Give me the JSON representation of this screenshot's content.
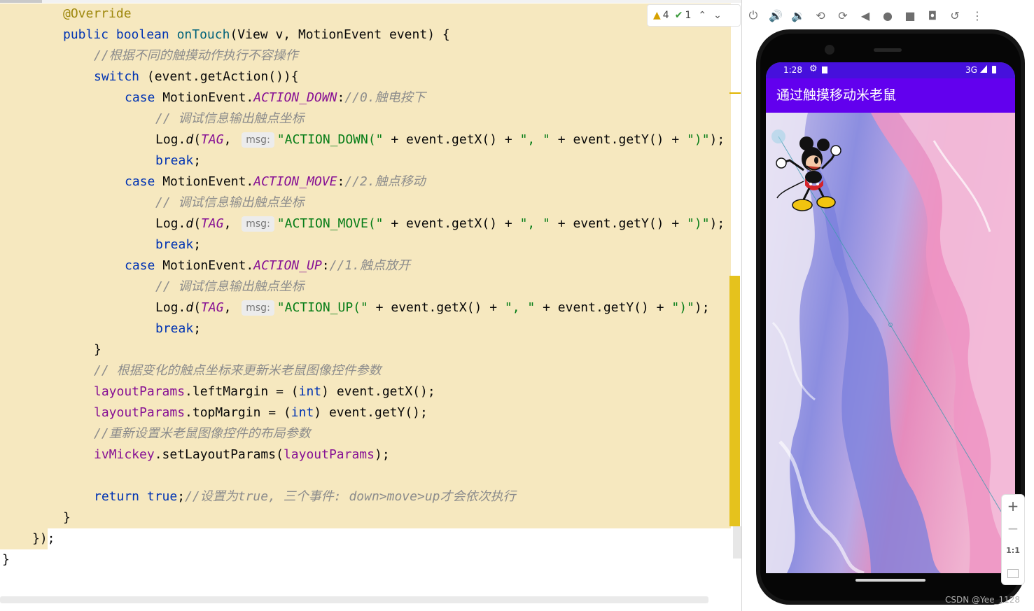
{
  "editor": {
    "inspections": {
      "warnings": "4",
      "checks": "1"
    },
    "code": {
      "l1_annotation": "@Override",
      "l2_public": "public",
      "l2_boolean": "boolean",
      "l2_method": "onTouch",
      "l2_params": "(View v, MotionEvent event) {",
      "l3_comment": "//根据不同的触摸动作执行不容操作",
      "l4_switch": "switch",
      "l4_rest": " (event.getAction()){",
      "case_kw": "case",
      "motion_event": " MotionEvent.",
      "l5_const": "ACTION_DOWN",
      "l5_comment": ":",
      "l5_comment2": "//0.触电按下",
      "debug_comment": "// 调试信息输出触点坐标",
      "log_d": "Log.",
      "d": "d",
      "tag": "TAG",
      "comma": ", ",
      "msg_hint": "msg:",
      "str_down": "\"ACTION_DOWN(\"",
      "getx_part": " + event.getX() + ",
      "str_sep": "\", \"",
      "gety_part": " + event.getY() + ",
      "str_close": "\")\"",
      "end_call": ");",
      "break_kw": "break",
      "semicolon": ";",
      "l9_const": "ACTION_MOVE",
      "l9_comment": "//2.触点移动",
      "str_move": "\"ACTION_MOVE(\"",
      "l13_const": "ACTION_UP",
      "l13_comment": "//1.触点放开",
      "str_up": "\"ACTION_UP(\"",
      "close_brace": "}",
      "l18_comment": "// 根据变化的触点坐标来更新米老鼠图像控件参数",
      "layout_params": "layoutParams",
      "left_margin_field": ".leftMargin",
      "top_margin_field": ".topMargin",
      "assign_cast_open": " = (",
      "int_kw": "int",
      "getx_end": ") event.getX();",
      "gety_end": ") event.getY();",
      "l21_comment": "//重新设置米老鼠图像控件的布局参数",
      "iv_mickey": "ivMickey",
      "set_layout": ".setLayoutParams(",
      "layout_params_arg": "layoutParams",
      "close_paren": ");",
      "return_kw": "return",
      "true_kw": "true",
      "l24_comment": "//设置为true, 三个事件: down>move>up才会依次执行",
      "end_anon": "});",
      "end_class": "}"
    }
  },
  "emulator": {
    "toolbar_icons": [
      "power-icon",
      "volume-up-icon",
      "volume-down-icon",
      "rotate-left-icon",
      "rotate-right-icon",
      "back-icon",
      "home-icon",
      "overview-icon",
      "camera-icon",
      "replay-icon",
      "more-icon"
    ],
    "status": {
      "time": "1:28",
      "network": "3G"
    },
    "app_title": "通过触摸移动米老鼠",
    "zoom": {
      "in": "+",
      "out": "−",
      "actual": "1:1"
    }
  },
  "watermark": "CSDN @Yee_1128",
  "colors": {
    "app_bar": "#6200ee",
    "status_bar": "#4610dc",
    "highlight": "#f6e8bf",
    "keyword": "#0033b3",
    "string": "#067d17",
    "comment": "#8c8c8c",
    "constant": "#871094"
  }
}
